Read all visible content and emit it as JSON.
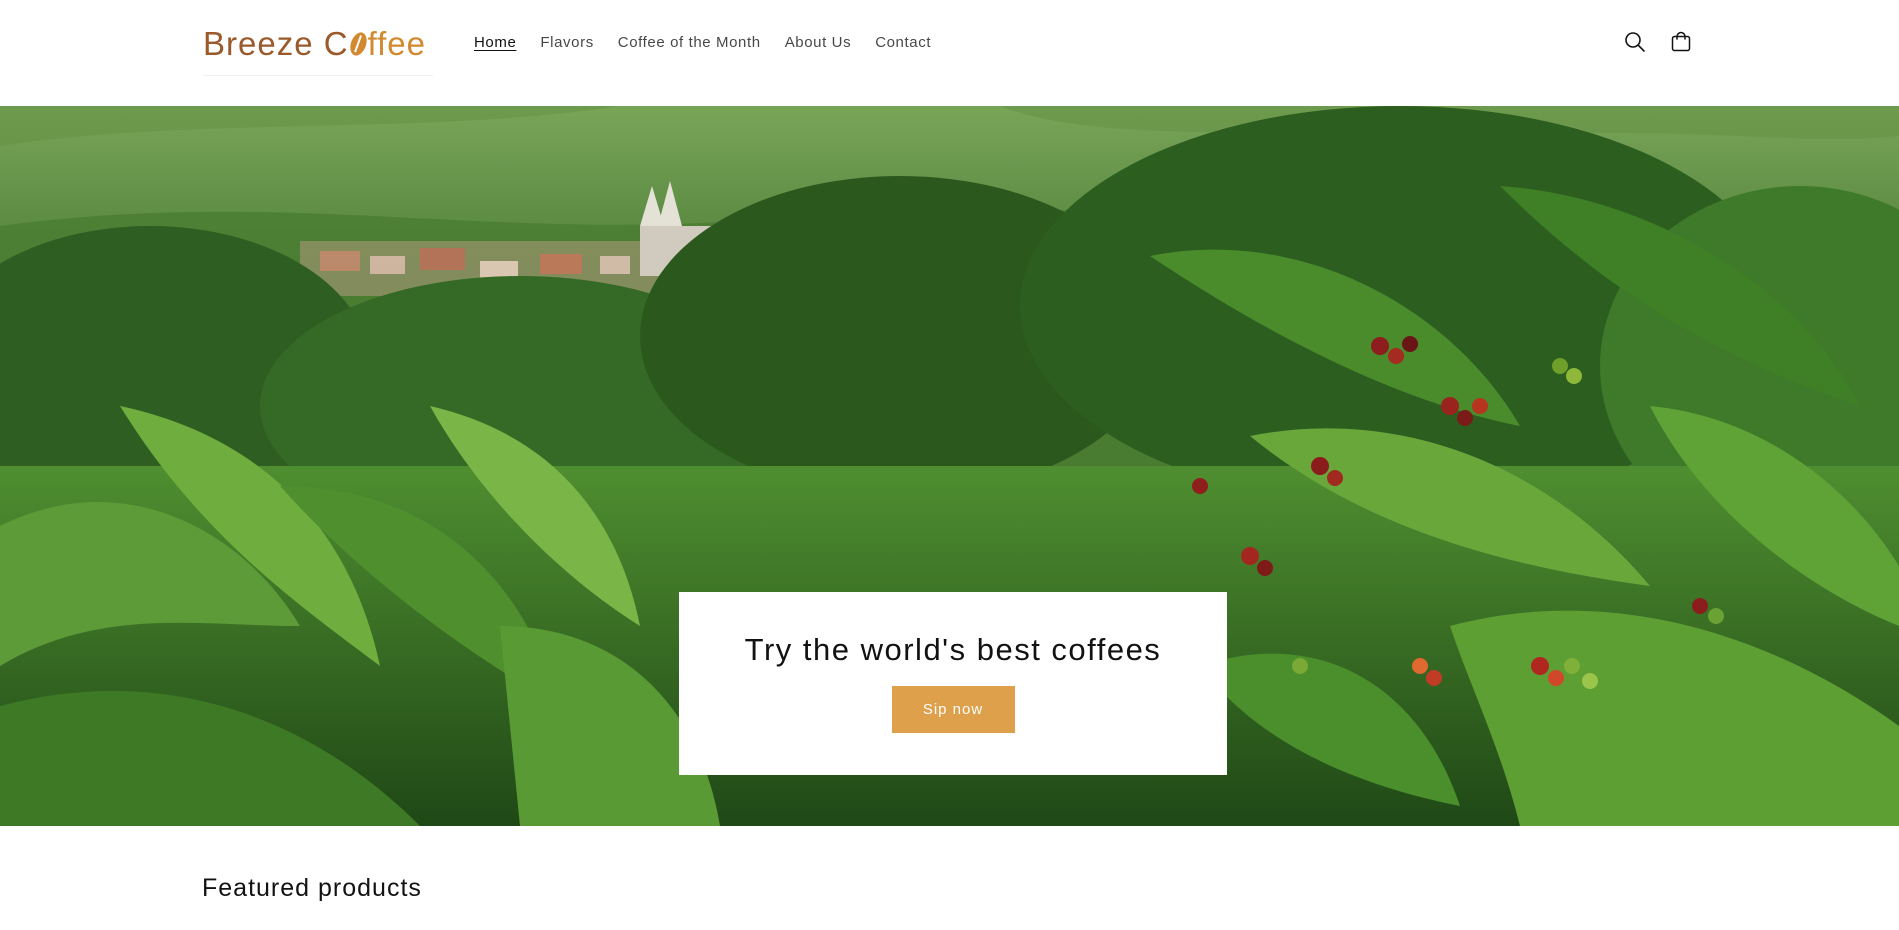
{
  "brand": {
    "logo_text_a": "Breeze C",
    "logo_text_b": "ffee",
    "logo_alt": "Breeze Coffee"
  },
  "nav": {
    "items": [
      {
        "label": "Home",
        "active": true
      },
      {
        "label": "Flavors",
        "active": false
      },
      {
        "label": "Coffee of the Month",
        "active": false
      },
      {
        "label": "About Us",
        "active": false
      },
      {
        "label": "Contact",
        "active": false
      }
    ]
  },
  "header_icons": {
    "search": "search-icon",
    "cart": "cart-icon"
  },
  "hero": {
    "title": "Try the world's best coffees",
    "button_label": "Sip now",
    "image": "coffee-plantation-photo"
  },
  "featured": {
    "title": "Featured products"
  },
  "colors": {
    "accent": "#dea04b",
    "logo_brown": "#9a5a2b",
    "logo_orange": "#d2892f",
    "text": "#121212",
    "background": "#ffffff"
  }
}
